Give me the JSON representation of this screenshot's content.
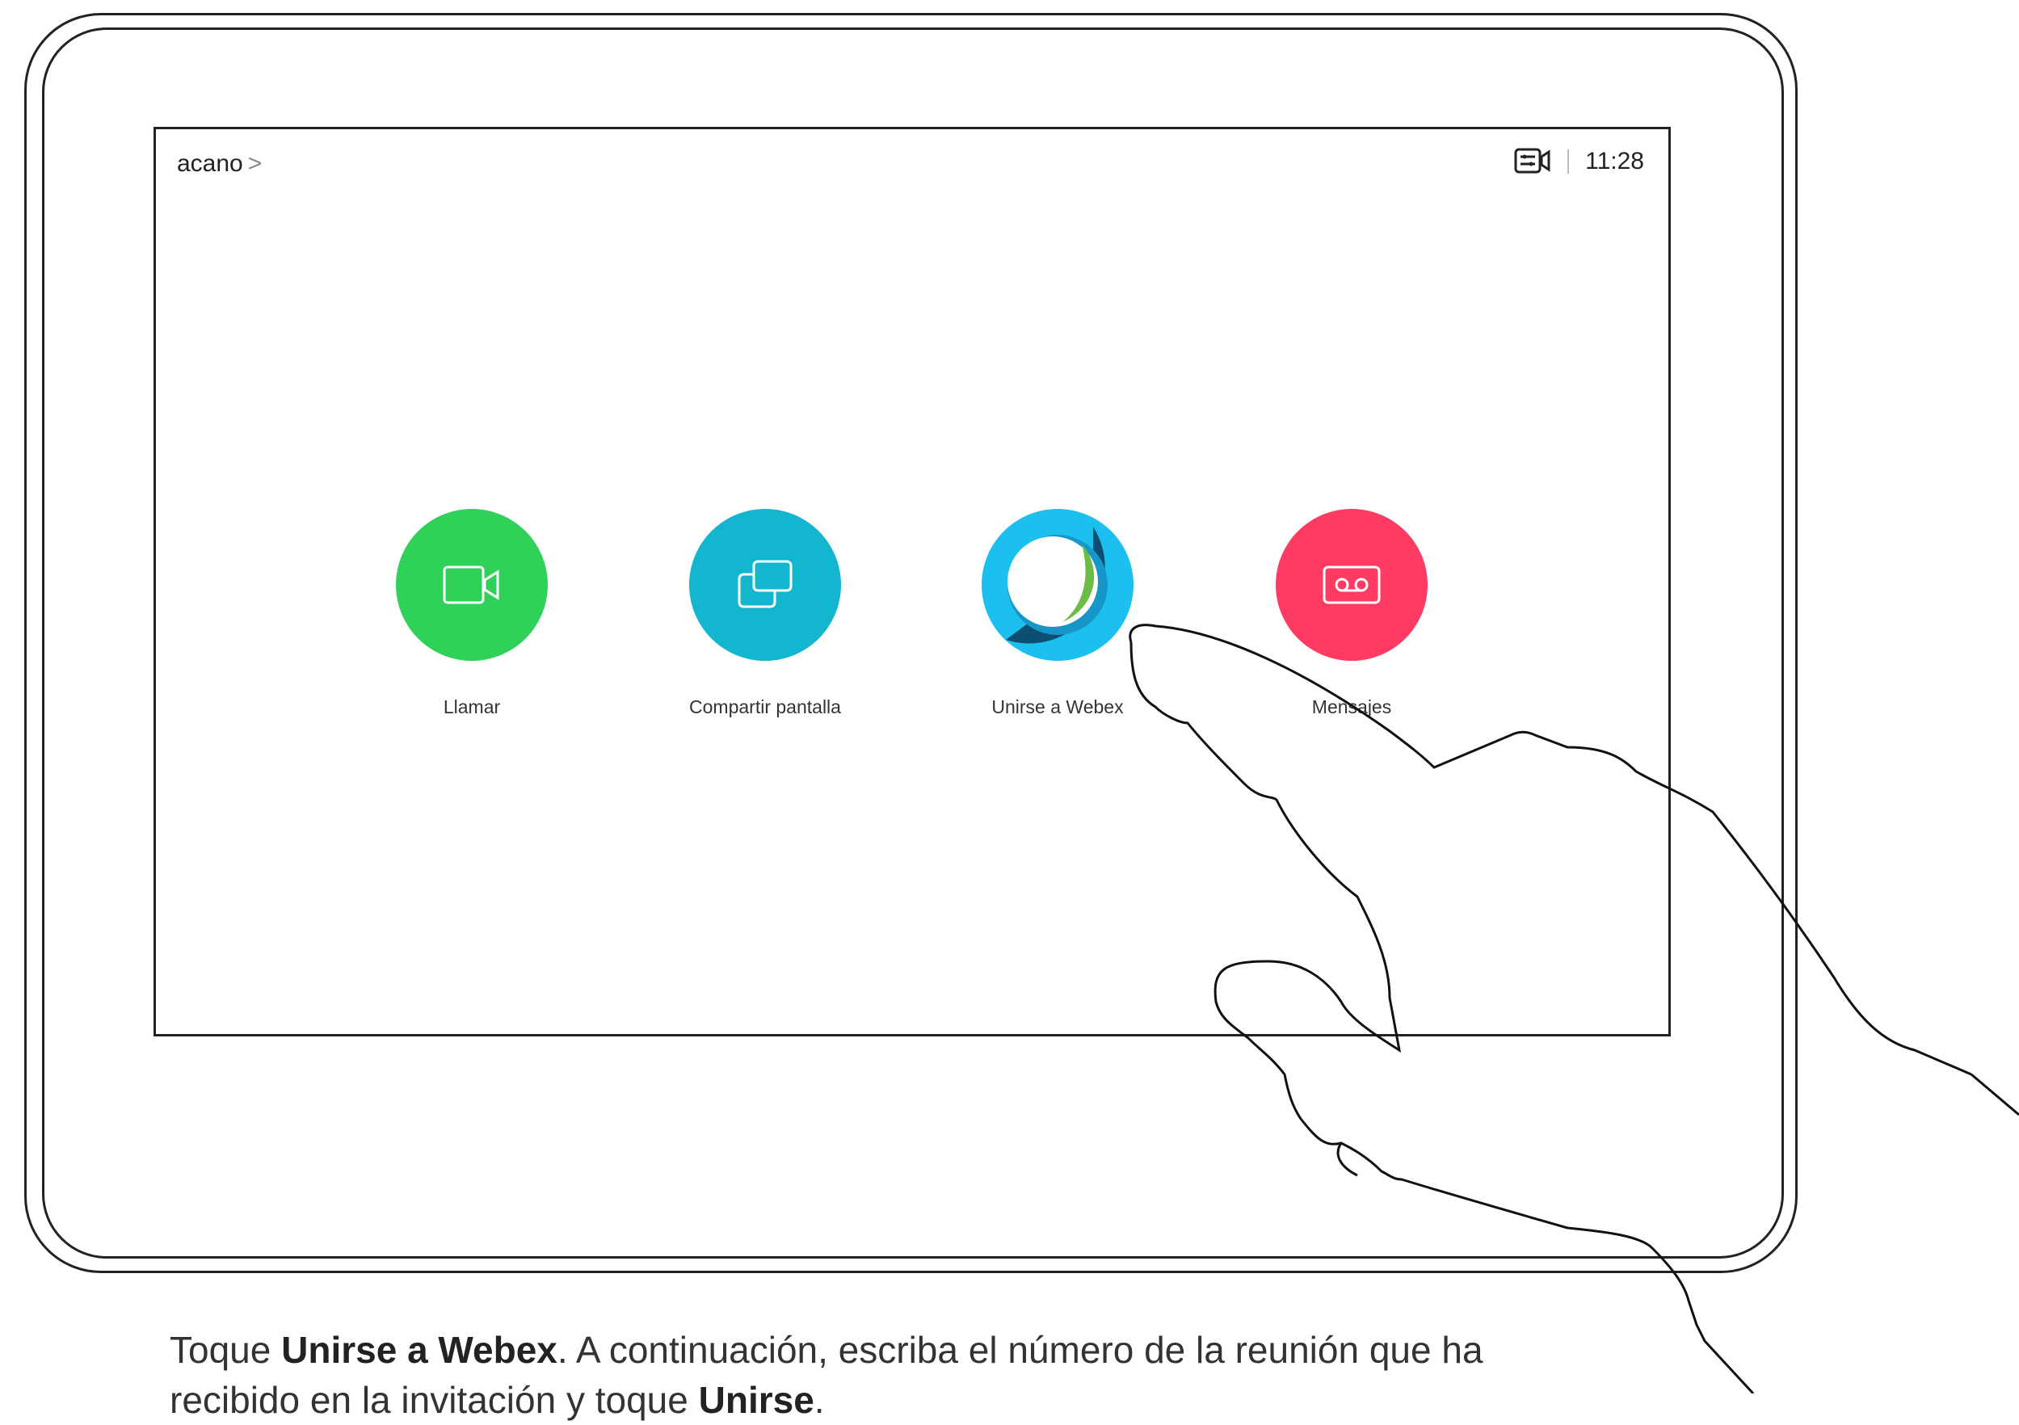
{
  "status_bar": {
    "room_name": "acano",
    "chevron": ">",
    "camera_status_icon": "camera-settings-icon",
    "clock": "11:28"
  },
  "actions": [
    {
      "label": "Llamar",
      "icon": "video-camera-icon",
      "color": "#2fd159"
    },
    {
      "label": "Compartir pantalla",
      "icon": "share-screen-icon",
      "color": "#12b6cf"
    },
    {
      "label": "Unirse a Webex",
      "icon": "webex-logo-icon",
      "color": "#0a7ea4"
    },
    {
      "label": "Mensajes",
      "icon": "voicemail-icon",
      "color": "#ff3b64"
    }
  ],
  "instruction": {
    "p1": "Toque ",
    "b1": "Unirse a Webex",
    "p2": ". A continuación, escriba el número de la reunión que ha recibido en la invitación y toque ",
    "b2": "Unirse",
    "p3": "."
  }
}
